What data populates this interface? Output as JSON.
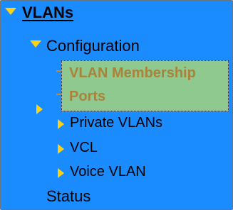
{
  "tree": {
    "root": {
      "label": "VLANs",
      "icon": "triangle-down-icon",
      "expanded": true
    },
    "configuration": {
      "label": "Configuration",
      "icon": "triangle-down-icon",
      "expanded": true
    },
    "selected_items": [
      {
        "label": "VLAN Membership"
      },
      {
        "label": "Ports"
      }
    ],
    "collapsed_items": [
      {
        "label": "Private VLANs",
        "icon": "triangle-right-icon"
      },
      {
        "label": "VCL",
        "icon": "triangle-right-icon"
      },
      {
        "label": "Voice VLAN",
        "icon": "triangle-right-icon"
      }
    ],
    "status": {
      "label": "Status"
    }
  },
  "colors": {
    "background": "#1a8cff",
    "arrow": "#ffd21a",
    "selection_bg": "#8fc98f",
    "selection_text": "#a8833a"
  }
}
